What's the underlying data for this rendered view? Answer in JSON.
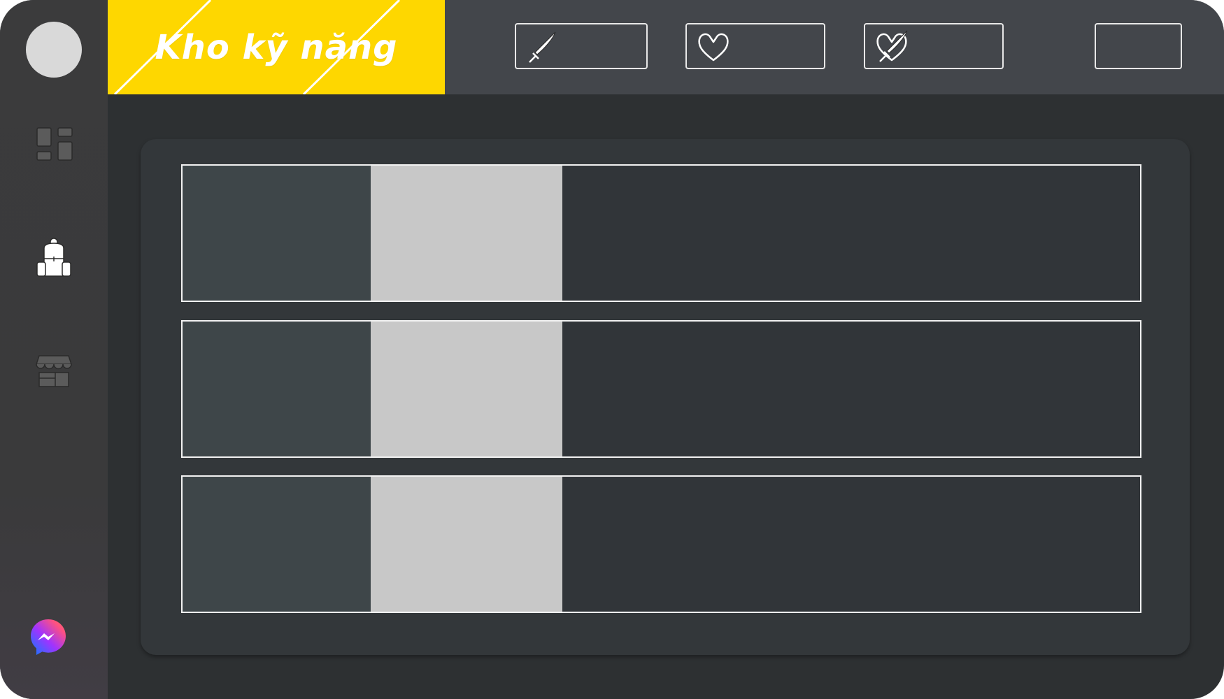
{
  "header": {
    "title": "Kho kỹ năng",
    "title_color": "#ffffff",
    "banner_color": "#fed700"
  },
  "stats": [
    {
      "icon": "sword-icon",
      "value": ""
    },
    {
      "icon": "heart-icon",
      "value": ""
    },
    {
      "icon": "heart-sword-icon",
      "value": ""
    },
    {
      "icon": "",
      "value": ""
    }
  ],
  "sidebar": {
    "items": [
      {
        "icon": "dashboard-icon"
      },
      {
        "icon": "backpack-icon"
      },
      {
        "icon": "shop-icon"
      }
    ],
    "chat_icon": "messenger-icon"
  },
  "skills": [
    {
      "name": "",
      "description": ""
    },
    {
      "name": "",
      "description": ""
    },
    {
      "name": "",
      "description": ""
    }
  ],
  "colors": {
    "background": "#2d3032",
    "sidebar": "#3b3b3c",
    "topbar": "#43464b",
    "panel": "#33373a",
    "card_icon_area": "#3e4649",
    "card_thumb_area": "#c8c8c8"
  }
}
